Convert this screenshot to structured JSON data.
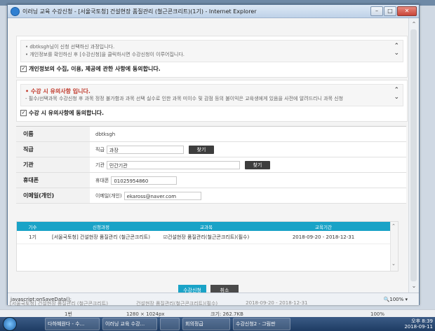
{
  "window": {
    "title": "이러닝 교육 수강신청 - [서울국토청] 건설현장 품질관리 (철근콘크리트)(1기) - Internet Explorer"
  },
  "notice1": {
    "lines": [
      "• dbtksgh님이 신청 선택하신 과정입니다.",
      "• 개인정보를 확인하신 후 [수강신청]을 클릭하시면 수강신청이 이루어집니다."
    ],
    "agree_label": "개인정보의 수집, 이용, 제공에 관한 사항에 동의합니다."
  },
  "notice2": {
    "heading": "• 수강 시 유의사항 입니다.",
    "line": "- 필수/선택과목 수강신청 후 과목 정정 불가함과 과목 선택 실수로 인한 과목 미이수 및 감점 등의 불이익은 교육생에게 있음을 사전에 알려드리니 과목 신청",
    "agree_label": "수강 시 유의사항에 동의합니다."
  },
  "form": {
    "name": {
      "label": "이름",
      "value": "dbtksgh"
    },
    "position": {
      "label": "직급",
      "prefix": "직급",
      "value": "과장",
      "button": "찾기"
    },
    "org": {
      "label": "기관",
      "prefix": "기관",
      "value": "민간기관",
      "button": "찾기"
    },
    "phone": {
      "label": "휴대폰",
      "prefix": "휴대폰",
      "value": "01025954860"
    },
    "email": {
      "label": "이메일(개인)",
      "prefix": "이메일(개인)",
      "value": "ekaross@naver.com"
    }
  },
  "course_table": {
    "headers": [
      "기수",
      "신청과정",
      "교과목",
      "교육기간"
    ],
    "rows": [
      {
        "cohort": "1기",
        "course": "[서울국토청] 건설현장 품질관리 (철근콘크리트)",
        "subject": "☑건설현장 품질관리(철근콘크리트)(필수)",
        "period": "2018-09-20 - 2018-12-31"
      }
    ]
  },
  "actions": {
    "apply": "수강신청",
    "cancel": "취소"
  },
  "statusbar": {
    "text": "javascript:onSaveData();",
    "zoom": "🔍100% ▾"
  },
  "background": {
    "row_course": "[서울국토청] 건설현장 품질관리 (철근콘크리트)",
    "row_subject": "건설현장 품질관리(철근콘크리트)(필수)",
    "row_period": "2018-09-20 - 2018-12-31",
    "status_cells": [
      "1번",
      "1280 × 1024px",
      "크기: 262.7KB",
      "100%"
    ]
  },
  "taskbar": {
    "items": [
      "다하혜원다 - 수...",
      "이러닝 교육 수강...",
      "",
      "회의정급",
      "수강신청2 - 그림판"
    ],
    "time": "오후 8:39",
    "date": "2018-09-11"
  }
}
